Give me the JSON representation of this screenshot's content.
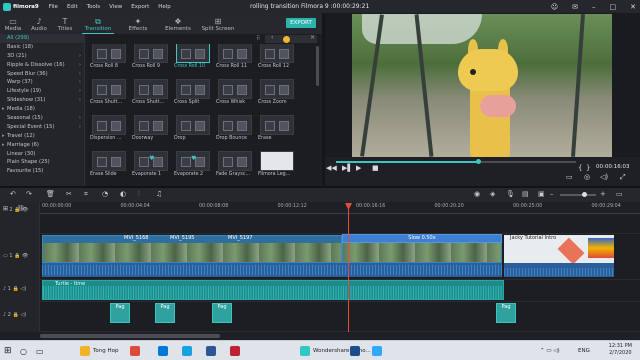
{
  "app": {
    "name": "filmora9",
    "window_title": "rolling transition Filmora 9 :00:00:29:21"
  },
  "menu": [
    "File",
    "Edit",
    "Tools",
    "View",
    "Export",
    "Help"
  ],
  "tabs": [
    {
      "label": "Media",
      "icon": "folder-icon"
    },
    {
      "label": "Audio",
      "icon": "music-note-icon"
    },
    {
      "label": "Titles",
      "icon": "text-icon"
    },
    {
      "label": "Transition",
      "icon": "transition-icon",
      "active": true
    },
    {
      "label": "Effects",
      "icon": "effects-icon"
    },
    {
      "label": "Elements",
      "icon": "elements-icon"
    },
    {
      "label": "Split Screen",
      "icon": "split-screen-icon"
    }
  ],
  "export_label": "EXPORT",
  "sidebar": [
    {
      "label": "All (299)",
      "active": true
    },
    {
      "label": "Basic (18)"
    },
    {
      "label": "3D (21)",
      "arrow": "›"
    },
    {
      "label": "Ripple & Dissolve (16)",
      "arrow": "›"
    },
    {
      "label": "Speed Blur (36)",
      "arrow": "›"
    },
    {
      "label": "Warp (37)",
      "arrow": "›"
    },
    {
      "label": "Lifestyle (19)",
      "arrow": "›"
    },
    {
      "label": "Slideshow (31)",
      "arrow": "›"
    },
    {
      "label": "Media (18)",
      "tri": "▸"
    },
    {
      "label": "Seasonal (15)",
      "arrow": "›"
    },
    {
      "label": "Special Event (15)",
      "arrow": "›"
    },
    {
      "label": "Travel (12)",
      "tri": "▸"
    },
    {
      "label": "Marriage (6)",
      "tri": "▸"
    },
    {
      "label": "Linear (30)"
    },
    {
      "label": "Plain Shape (25)"
    },
    {
      "label": "Favourite (15)"
    }
  ],
  "transitions": [
    {
      "label": "Cross Roll 8"
    },
    {
      "label": "Cross Roll 9"
    },
    {
      "label": "Cross Roll 10",
      "selected": true
    },
    {
      "label": "Cross Roll 11"
    },
    {
      "label": "Cross Roll 12"
    },
    {
      "label": "Cross Shutt..."
    },
    {
      "label": "Cross Shutt..."
    },
    {
      "label": "Cross Split"
    },
    {
      "label": "Cross Whisk"
    },
    {
      "label": "Cross Zoom"
    },
    {
      "label": "Dispersion ..."
    },
    {
      "label": "Doorway"
    },
    {
      "label": "Drop"
    },
    {
      "label": "Drop Bounce"
    },
    {
      "label": "Erase"
    },
    {
      "label": "Erase Slide"
    },
    {
      "label": "Evaporate 1",
      "fav": true
    },
    {
      "label": "Evaporate 2",
      "fav": true
    },
    {
      "label": "Fade Graysc..."
    },
    {
      "label": "Filmora Leg...",
      "light": true
    }
  ],
  "preview": {
    "time": "00:00:16:03",
    "progress": 0.59
  },
  "ruler": [
    "00:00:00:00",
    "00:00:04:04",
    "00:00:08:08",
    "00:00:12:12",
    "00:00:16:16",
    "00:00:20:20",
    "00:00:25:00",
    "00:00:29:04"
  ],
  "track_labels": [
    {
      "label": "2"
    },
    {
      "label": "1"
    },
    {
      "label": "1"
    },
    {
      "label": "2"
    }
  ],
  "clips": {
    "video": [
      {
        "label": "MVI_5168"
      },
      {
        "label": "MVI_5195"
      },
      {
        "label": "MVI_5197"
      }
    ],
    "slow_label": "Slow 0.50x",
    "title_clip": "Jacky Tutorial Intro",
    "music_label": "Turtle - time",
    "pg_label": "Pag"
  },
  "taskbar": {
    "items": [
      {
        "label": "Tong Hop",
        "color": "#f0b429"
      },
      {
        "label": "",
        "color": "#dd4b39"
      },
      {
        "label": "",
        "color": "#0078d7"
      },
      {
        "label": "",
        "color": "#1ba1e2"
      },
      {
        "label": "",
        "color": "#2b5797"
      },
      {
        "label": "",
        "color": "#bb2233"
      },
      {
        "label": "Wondershare Filmo...",
        "color": "#2fc9c4"
      },
      {
        "label": "",
        "color": "#1e4d8c"
      },
      {
        "label": "",
        "color": "#31a8ff"
      }
    ],
    "lang": "ENG",
    "time": "12:31 PM",
    "date": "2/7/2020"
  },
  "colors": {
    "accent": "#3fc6c0",
    "video_clip": "#2f6fa0",
    "music_clip": "#1e8b8a",
    "playhead": "#e84b3c"
  }
}
